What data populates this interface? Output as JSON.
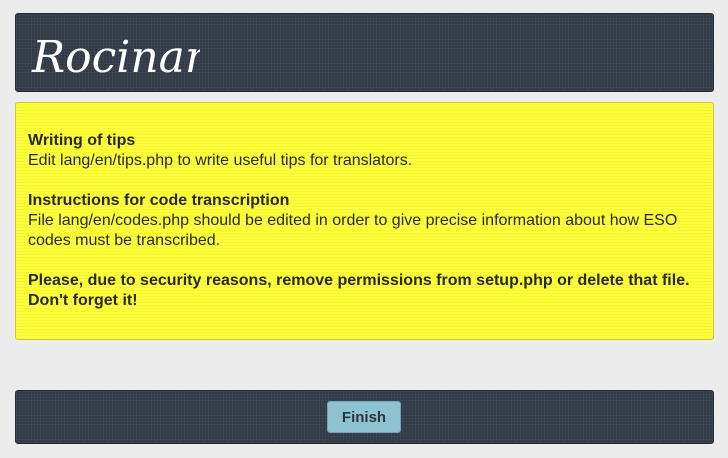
{
  "header": {
    "logo_text": "Rocinante"
  },
  "notice": {
    "tips": [
      {
        "title": "Writing of tips",
        "body": "Edit lang/en/tips.php to write useful tips for translators."
      },
      {
        "title": "Instructions for code transcription",
        "body": "File lang/en/codes.php should be edited in order to give precise information about how ESO codes must be transcribed."
      }
    ],
    "warning": "Please, due to security reasons, remove permissions from setup.php or delete that file. Don't forget it!"
  },
  "footer": {
    "finish_label": "Finish"
  },
  "colors": {
    "page_background": "#ececec",
    "dark_panel": "#323a47",
    "notice_background": "#ffff3a",
    "button_background": "#8ec2d0"
  }
}
